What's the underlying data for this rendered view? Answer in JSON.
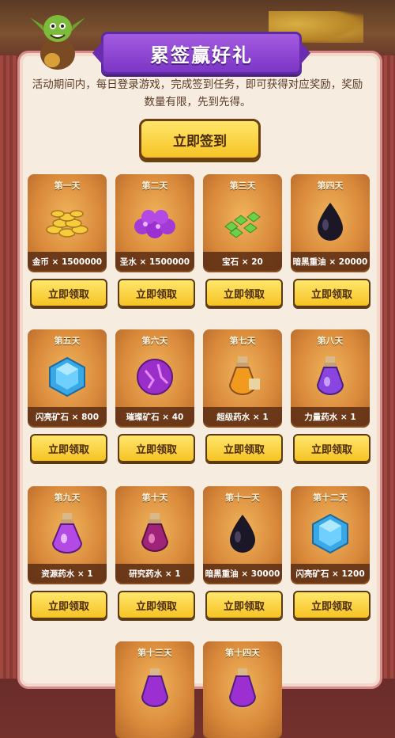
{
  "title": "累签赢好礼",
  "description": "活动期间内，每日登录游戏，完成签到任务，即可获得对应奖励，奖励数量有限，先到先得。",
  "checkin_button": "立即签到",
  "claim_label": "立即领取",
  "rewards": [
    {
      "day": "第一天",
      "amount": "金币 × 1500000",
      "icon": "gold-coins-icon"
    },
    {
      "day": "第二天",
      "amount": "圣水 × 1500000",
      "icon": "elixir-icon"
    },
    {
      "day": "第三天",
      "amount": "宝石 × 20",
      "icon": "gems-icon"
    },
    {
      "day": "第四天",
      "amount": "暗黑重油 × 20000",
      "icon": "dark-elixir-icon"
    },
    {
      "day": "第五天",
      "amount": "闪亮矿石 × 800",
      "icon": "shiny-ore-icon"
    },
    {
      "day": "第六天",
      "amount": "璀璨矿石 × 40",
      "icon": "glowy-ore-icon"
    },
    {
      "day": "第七天",
      "amount": "超级药水 × 1",
      "icon": "super-potion-icon"
    },
    {
      "day": "第八天",
      "amount": "力量药水 × 1",
      "icon": "power-potion-icon"
    },
    {
      "day": "第九天",
      "amount": "资源药水 × 1",
      "icon": "resource-potion-icon"
    },
    {
      "day": "第十天",
      "amount": "研究药水 × 1",
      "icon": "research-potion-icon"
    },
    {
      "day": "第十一天",
      "amount": "暗黑重油 × 30000",
      "icon": "dark-elixir-icon"
    },
    {
      "day": "第十二天",
      "amount": "闪亮矿石 × 1200",
      "icon": "shiny-ore-icon"
    },
    {
      "day": "第十三天",
      "amount": "",
      "icon": "potion-icon"
    },
    {
      "day": "第十四天",
      "amount": "",
      "icon": "potion-icon"
    }
  ],
  "colors": {
    "title_banner": "#7c36c6",
    "button": "#f6c324",
    "card": "#d9893a",
    "board": "#f6ece0"
  }
}
